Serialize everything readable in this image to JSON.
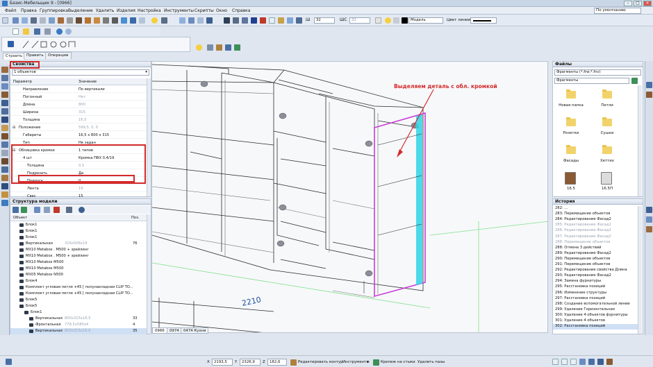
{
  "window": {
    "title": "Базис-Мебельщик 9 - [0966]"
  },
  "menu": [
    "Файл",
    "Правка",
    "Группировка",
    "Выделение",
    "Удалить",
    "Изделия",
    "Настройка",
    "Инструменты",
    "Скрипты",
    "Окно",
    "Справка"
  ],
  "toolbar": {
    "view_mode": "По умолчанию",
    "thickness_label": "Ш",
    "thickness_value": "32",
    "depth_label": "ШС",
    "depth_value": "32",
    "layer": "Модель",
    "line_color_label": "Цвет линии:"
  },
  "tabs": [
    "Строить",
    "Править",
    "Операции"
  ],
  "properties": {
    "title": "Свойства",
    "selection": "1 объектов",
    "col_param": "Параметр",
    "col_value": "Значение",
    "rows": [
      {
        "name": "Направление",
        "value": "По вертикали",
        "dim": false,
        "indent": 1
      },
      {
        "name": "Погонный",
        "value": "Нет",
        "dim": true,
        "indent": 1
      },
      {
        "name": "Длина",
        "value": "800",
        "dim": true,
        "indent": 1
      },
      {
        "name": "Ширина",
        "value": "315",
        "dim": true,
        "indent": 1
      },
      {
        "name": "Толщина",
        "value": "16,5",
        "dim": true,
        "indent": 1
      },
      {
        "name": "Положение",
        "value": "599,5, 0, 0",
        "dim": true,
        "indent": 0
      },
      {
        "name": "Габариты",
        "value": "16,5 x 800 x 315",
        "dim": false,
        "indent": 1
      },
      {
        "name": "Тип",
        "value": "Не задан",
        "dim": false,
        "indent": 1
      },
      {
        "name": "Облицовка кромки",
        "value": "1 типов",
        "dim": false,
        "indent": 0
      },
      {
        "name": "4 шт",
        "value": "Кромка ПВХ 0,4/19",
        "dim": false,
        "indent": 1
      },
      {
        "name": "Толщина",
        "value": "0,5",
        "dim": true,
        "indent": 2
      },
      {
        "name": "Подрезать",
        "value": "Да",
        "dim": false,
        "indent": 2
      },
      {
        "name": "Припуск",
        "value": "0",
        "dim": false,
        "indent": 2
      },
      {
        "name": "Лента",
        "value": "19",
        "dim": true,
        "indent": 2
      },
      {
        "name": "Свес",
        "value": "15",
        "dim": false,
        "indent": 2
      }
    ]
  },
  "model_tree": {
    "title": "Структура модели",
    "col_object": "Объект",
    "col_pos": "Поз.",
    "rows": [
      {
        "name": "Блок1",
        "size": "",
        "pos": "",
        "indent": 1
      },
      {
        "name": "Блок1",
        "size": "",
        "pos": "",
        "indent": 1
      },
      {
        "name": "Блок1",
        "size": "",
        "pos": "",
        "indent": 1
      },
      {
        "name": "Вертикальная",
        "size": "316x506x19",
        "pos": "76",
        "indent": 1
      },
      {
        "name": "MX10 Metabox . M500 + зрейлинг",
        "size": "",
        "pos": "",
        "indent": 1
      },
      {
        "name": "MX10 Metabox . M500 + зрейлинг",
        "size": "",
        "pos": "",
        "indent": 1
      },
      {
        "name": "MX10 Metabox M500",
        "size": "",
        "pos": "",
        "indent": 1
      },
      {
        "name": "MX10 Metabox M500",
        "size": "",
        "pos": "",
        "indent": 1
      },
      {
        "name": "MX05 Metabox  N500",
        "size": "",
        "pos": "",
        "indent": 1
      },
      {
        "name": "Блок4",
        "size": "",
        "pos": "",
        "indent": 1
      },
      {
        "name": "Комплект угловая петля +45 [ полунакладная CLIP TO...",
        "size": "",
        "pos": "",
        "indent": 1
      },
      {
        "name": "Комплект угловая петля +45 [ полунакладная CLIP TO...",
        "size": "",
        "pos": "",
        "indent": 1
      },
      {
        "name": "Блок5",
        "size": "",
        "pos": "",
        "indent": 1
      },
      {
        "name": "Блок5",
        "size": "",
        "pos": "",
        "indent": 1
      },
      {
        "name": "Блок1",
        "size": "",
        "pos": "",
        "indent": 2
      },
      {
        "name": "Вертикальная",
        "size": "800x315x16,5",
        "pos": "33",
        "indent": 3
      },
      {
        "name": "Фронтальная",
        "size": "778,5x580x4",
        "pos": "4",
        "indent": 3
      },
      {
        "name": "Вертикальная",
        "size": "800x315x16,5",
        "pos": "35",
        "indent": 3
      }
    ]
  },
  "viewport": {
    "annotation": "Выделяем деталь с обл. кромкой",
    "dimension": "2210",
    "tabs": [
      "0966",
      "0974",
      "0474 Кухня"
    ]
  },
  "files": {
    "title": "Файлы",
    "filter": "Фрагменты (*.frw;*.fnv)",
    "path": "Фрагменты",
    "items": [
      {
        "name": "Новая папка",
        "kind": "folder"
      },
      {
        "name": "Петли",
        "kind": "folder"
      },
      {
        "name": "Розетки",
        "kind": "folder"
      },
      {
        "name": "Сушки",
        "kind": "folder"
      },
      {
        "name": "Фасады",
        "kind": "folder"
      },
      {
        "name": "Хеттих",
        "kind": "folder"
      },
      {
        "name": "16.5",
        "kind": "file"
      },
      {
        "name": "16.5П",
        "kind": "file"
      }
    ]
  },
  "history": {
    "title": "История",
    "items": [
      {
        "text": "282: ...",
        "dim": false
      },
      {
        "text": "283: Перемещение объектов",
        "dim": false
      },
      {
        "text": "284: Редактирование Фасад2",
        "dim": false
      },
      {
        "text": "285: Редактирование Фасад2",
        "dim": true
      },
      {
        "text": "286: Редактирование Фасад2",
        "dim": true
      },
      {
        "text": "287: Редактирование Фасад2",
        "dim": true
      },
      {
        "text": "288: Перемещение объектов",
        "dim": true
      },
      {
        "text": "288: Отмена 3 действий",
        "dim": false
      },
      {
        "text": "289: Редактирование Фасад2",
        "dim": false
      },
      {
        "text": "290: Перемещение объектов",
        "dim": false
      },
      {
        "text": "291: Перемещение объектов",
        "dim": false
      },
      {
        "text": "292: Редактирование свойства Длина",
        "dim": false
      },
      {
        "text": "293: Редактирование Фасад2",
        "dim": false
      },
      {
        "text": "294: Замена фурнитуры",
        "dim": false
      },
      {
        "text": "295: Расстановка позиций",
        "dim": false
      },
      {
        "text": "296: Изменение структуры",
        "dim": false
      },
      {
        "text": "297: Расстановка позиций",
        "dim": false
      },
      {
        "text": "298: Создание вспомогательной линии",
        "dim": false
      },
      {
        "text": "299: Удаление Горизонтальная",
        "dim": false
      },
      {
        "text": "300: Удаление 4 объектов фурнитуры",
        "dim": false
      },
      {
        "text": "301: Удаление 4 объектов",
        "dim": false
      },
      {
        "text": "302: Расстановка позиций",
        "dim": false
      }
    ]
  },
  "status": {
    "x_label": "X",
    "x_value": "2193,5",
    "y_label": "Y",
    "y_value": "2326,9",
    "z_label": "Z",
    "z_value": "182,6",
    "edit_contour": "Редактировать контур",
    "tools": "Инструменты",
    "fastener": "Крепеж на стыки",
    "remove_slots": "Удалить пазы"
  },
  "colors": {
    "selection": "#c83cd6",
    "edge": "#2fd3e6",
    "annotation": "#d42a2a"
  }
}
